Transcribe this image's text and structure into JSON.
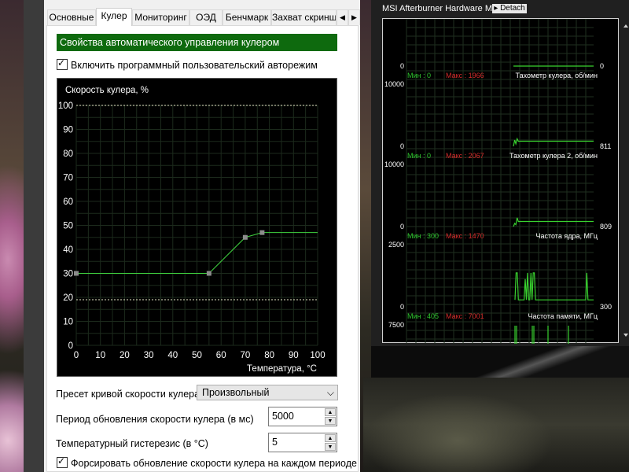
{
  "tabs": [
    "Основные",
    "Кулер",
    "Мониторинг",
    "ОЭД",
    "Бенчмарк",
    "Захват скринш"
  ],
  "active_tab": "Кулер",
  "fan_section": {
    "header": "Свойства автоматического управления кулером",
    "enable_checkbox": {
      "label": "Включить программный пользовательский авторежим",
      "checked": true
    }
  },
  "fan_curve": {
    "y_title": "Скорость кулера, %",
    "x_title": "Температура, °C",
    "y_ticks": [
      "100",
      "90",
      "80",
      "70",
      "60",
      "50",
      "40",
      "30",
      "20",
      "10",
      "0"
    ],
    "x_ticks": [
      "0",
      "10",
      "20",
      "30",
      "40",
      "50",
      "60",
      "70",
      "80",
      "90",
      "100"
    ],
    "xlim": [
      0,
      100
    ],
    "ylim": [
      0,
      100
    ],
    "upper_limit": 100,
    "lower_limit": 19,
    "points": [
      [
        0,
        30
      ],
      [
        55,
        30
      ],
      [
        70,
        45
      ],
      [
        77,
        47
      ]
    ],
    "line_end": [
      100,
      47
    ]
  },
  "form": {
    "preset_label": "Пресет кривой скорости кулера",
    "preset_value": "Произвольный",
    "period_label": "Период обновления скорости кулера (в мс)",
    "period_value": "5000",
    "hysteresis_label": "Температурный гистерезис (в °C)",
    "hysteresis_value": "5",
    "force_checkbox": {
      "label": "Форсировать обновление скорости кулера на каждом периоде",
      "checked": true
    }
  },
  "monitor": {
    "title": "MSI Afterburner Hardware Monitor",
    "detach_label": "Detach",
    "colors": {
      "line": "#39d22f",
      "min": "#2ec52e",
      "max": "#d62b2b",
      "grid": "#1f2f1f"
    },
    "graphs": [
      {
        "name": "Тахометр кулера, об/мин",
        "min_label": "Мин : 0",
        "max_label": "Макс : 1966",
        "top": "",
        "bottom": "0",
        "current": "0",
        "samples": [
          0,
          0,
          0,
          0,
          0,
          0,
          0,
          0,
          0,
          0,
          0,
          0,
          0,
          0,
          0,
          0,
          0,
          0,
          0,
          0,
          0,
          0,
          0,
          0,
          0,
          0,
          0,
          0,
          0,
          0,
          0,
          0,
          0,
          0,
          0,
          0,
          0,
          0,
          0,
          0,
          0,
          0,
          0,
          0,
          0,
          0,
          0,
          0,
          0,
          0,
          0,
          0,
          0,
          0,
          0,
          0,
          0,
          0,
          0,
          0,
          0,
          0,
          0,
          0,
          0,
          0
        ]
      },
      {
        "name": "Тахометр кулера 2, об/мин",
        "min_label": "Мин : 0",
        "max_label": "Макс : 2067",
        "top": "10000",
        "bottom": "0",
        "current": "811",
        "samples": [
          0,
          1000,
          400,
          1200,
          800,
          810,
          811,
          811,
          811,
          811,
          811,
          811,
          811,
          811,
          811,
          811,
          811,
          811,
          811,
          811,
          811,
          811,
          811,
          811,
          811,
          811,
          811,
          811,
          811,
          811,
          811,
          811,
          811,
          811,
          811,
          811,
          811,
          811,
          811,
          811,
          811,
          811,
          811,
          811,
          811,
          811,
          811,
          811,
          811,
          811,
          811,
          811,
          811,
          811,
          811,
          811,
          811,
          811,
          811,
          811,
          811,
          811,
          811,
          811,
          811,
          811
        ]
      },
      {
        "name": "Частота ядра, МГц",
        "min_label": "Мин : 300",
        "max_label": "Макс : 1470",
        "top": "10000",
        "bottom": "0",
        "current": "809",
        "samples": [
          0,
          500,
          300,
          1400,
          800,
          810,
          809,
          809,
          809,
          809,
          809,
          809,
          809,
          809,
          809,
          809,
          809,
          809,
          809,
          809,
          809,
          809,
          809,
          809,
          809,
          809,
          809,
          809,
          809,
          809,
          809,
          809,
          809,
          809,
          809,
          809,
          809,
          809,
          809,
          809,
          809,
          809,
          809,
          809,
          809,
          809,
          809,
          809,
          809,
          809,
          809,
          809,
          809,
          809,
          809,
          809,
          809,
          809,
          809,
          809,
          809,
          809,
          809,
          809,
          809,
          809
        ]
      },
      {
        "name": "Частота памяти, МГц",
        "min_label": "Мин : 405",
        "max_label": "Макс : 7001",
        "top": "2500",
        "bottom": "0",
        "current": "300",
        "samples": [
          300,
          1470,
          1470,
          300,
          300,
          300,
          300,
          300,
          300,
          1200,
          300,
          1470,
          300,
          300,
          1470,
          300,
          1470,
          1470,
          300,
          300,
          300,
          300,
          300,
          300,
          300,
          300,
          300,
          300,
          300,
          300,
          300,
          300,
          300,
          300,
          300,
          300,
          300,
          300,
          300,
          300,
          300,
          300,
          300,
          300,
          300,
          300,
          300,
          300,
          300,
          300,
          300,
          300,
          300,
          300,
          300,
          300,
          300,
          300,
          300,
          300,
          300,
          300,
          300,
          1470,
          300,
          300,
          300,
          300,
          300,
          300
        ]
      },
      {
        "name": "",
        "min_label": "",
        "max_label": "",
        "top": "7500",
        "bottom": "",
        "current": "",
        "samples": []
      }
    ]
  }
}
